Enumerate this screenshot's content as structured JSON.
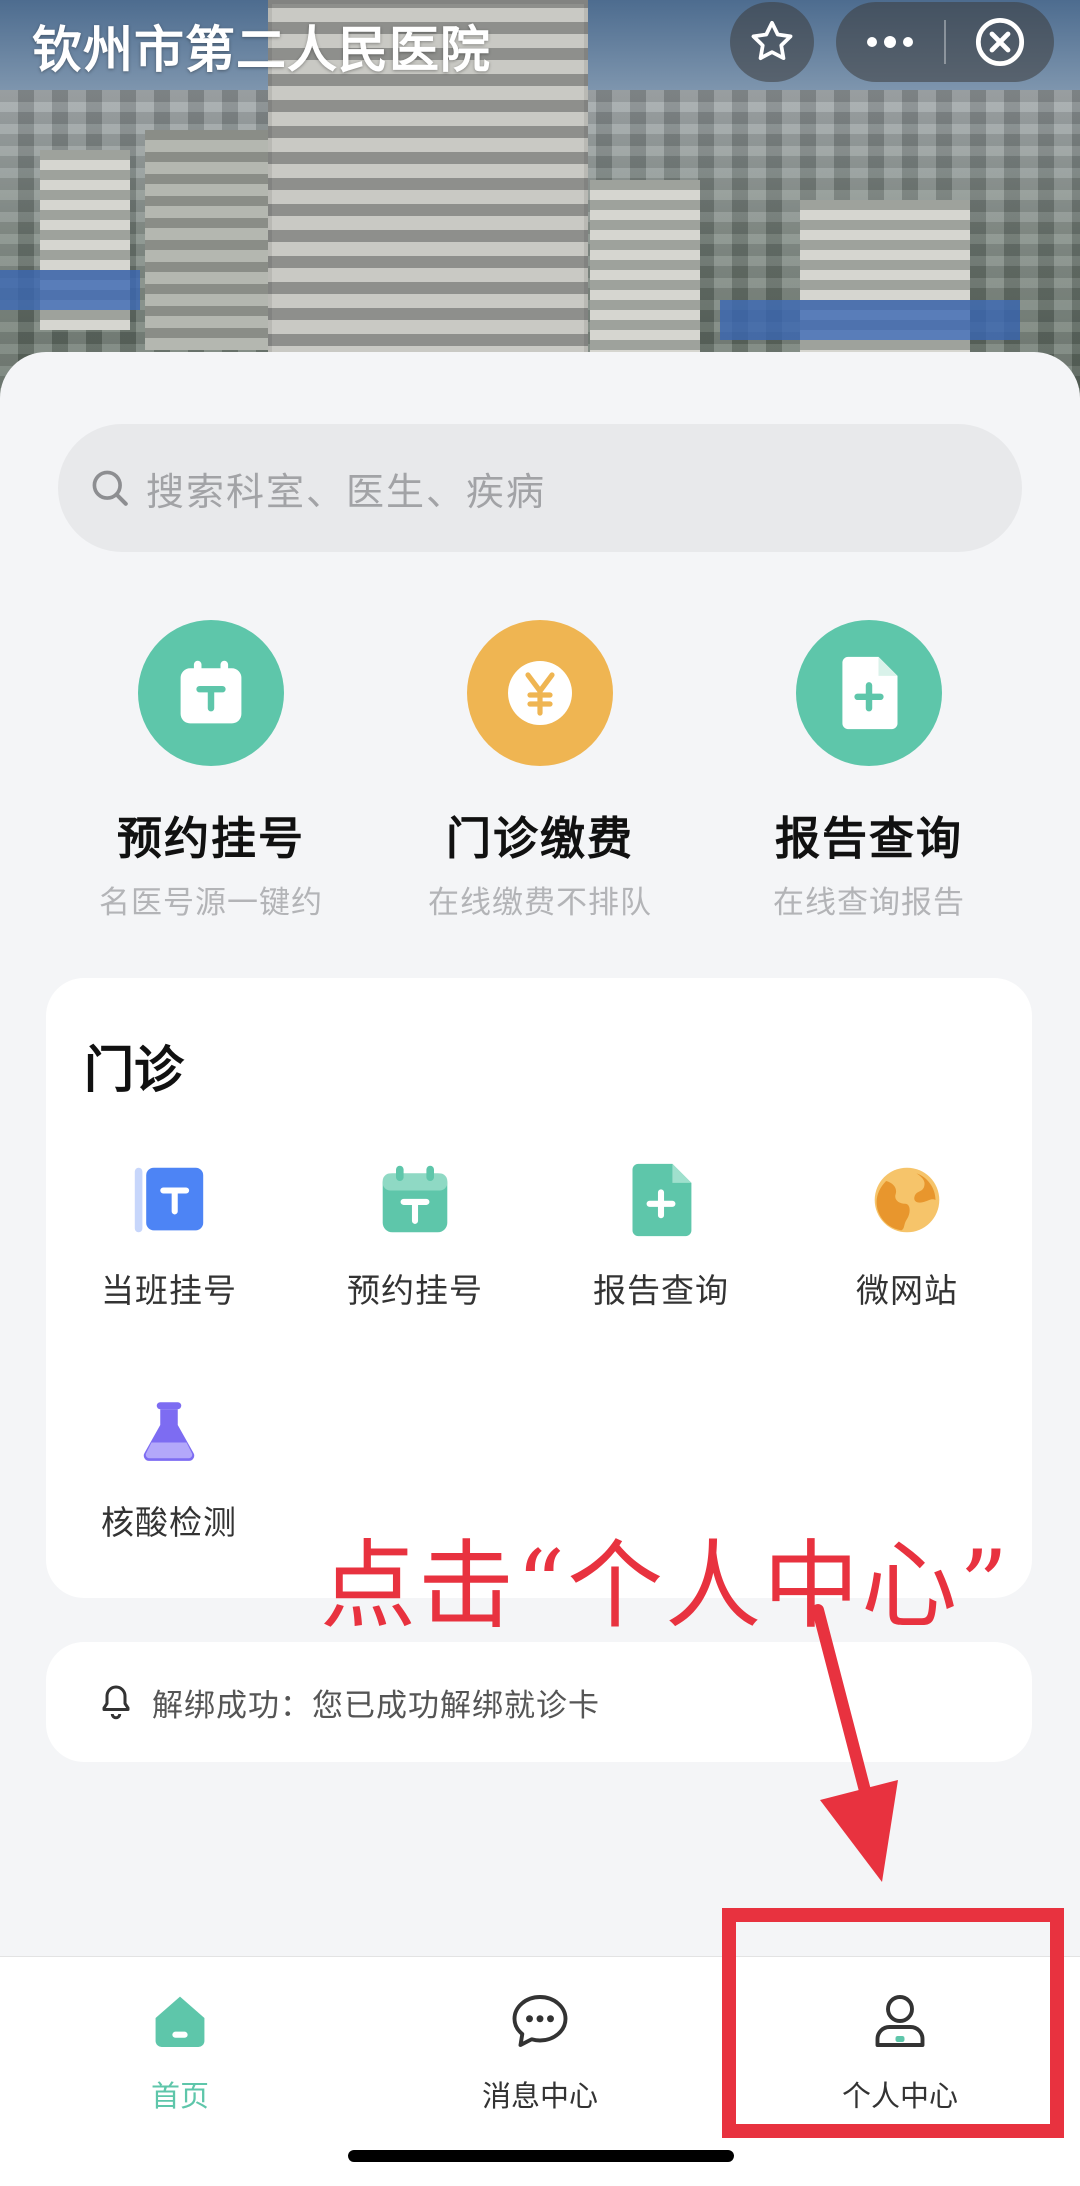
{
  "header": {
    "title": "钦州市第二人民医院",
    "capsule": {
      "favorite_icon": "star-icon",
      "more_icon": "more-dots-icon",
      "close_icon": "close-circle-icon"
    }
  },
  "search": {
    "placeholder": "搜索科室、医生、疾病",
    "icon": "search-icon"
  },
  "quick_actions": [
    {
      "title": "预约挂号",
      "subtitle": "名医号源一键约",
      "icon": "calendar-icon",
      "color": "#5ec6aa"
    },
    {
      "title": "门诊缴费",
      "subtitle": "在线缴费不排队",
      "icon": "yuan-coin-icon",
      "color": "#efb552"
    },
    {
      "title": "报告查询",
      "subtitle": "在线查询报告",
      "icon": "report-doc-icon",
      "color": "#5ec6aa"
    }
  ],
  "outpatient": {
    "title": "门诊",
    "services": [
      {
        "label": "当班挂号",
        "icon": "ticket-card-icon",
        "color": "#4d84f5"
      },
      {
        "label": "预约挂号",
        "icon": "calendar-icon",
        "color": "#5ec6aa"
      },
      {
        "label": "报告查询",
        "icon": "report-doc-icon",
        "color": "#5ec6aa"
      },
      {
        "label": "微网站",
        "icon": "globe-icon",
        "color": "#efb552"
      },
      {
        "label": "核酸检测",
        "icon": "flask-icon",
        "color": "#7d6cf2"
      }
    ]
  },
  "notice": {
    "icon": "bell-icon",
    "text": "解绑成功：您已成功解绑就诊卡"
  },
  "tabbar": {
    "items": [
      {
        "label": "首页",
        "icon": "home-icon",
        "active": true
      },
      {
        "label": "消息中心",
        "icon": "chat-bubble-icon",
        "active": false
      },
      {
        "label": "个人中心",
        "icon": "user-icon",
        "active": false
      }
    ],
    "active_color": "#5ec6aa"
  },
  "annotation": {
    "text": "点击“个人中心”",
    "color": "#e8323f"
  }
}
